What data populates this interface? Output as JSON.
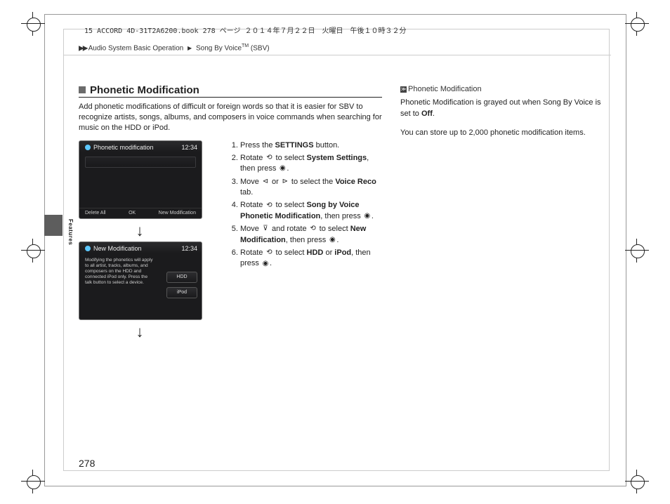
{
  "header": {
    "meta_line": "15 ACCORD 4D-31T2A6200.book  278 ページ  ２０１４年７月２２日　火曜日　午後１０時３２分"
  },
  "breadcrumb": {
    "arrows": "▶▶",
    "part1": "Audio System Basic Operation",
    "part2": "Song By Voice",
    "tm": "TM",
    "suffix": " (SBV)"
  },
  "section": {
    "title": "Phonetic Modification",
    "intro": "Add phonetic modifications of difficult or foreign words so that it is easier for SBV to recognize artists, songs, albums, and composers in voice commands when searching for music on the HDD or iPod."
  },
  "screens": {
    "screen1": {
      "title": "Phonetic modification",
      "time": "12:34",
      "slot_text": "",
      "bottom_left": "Delete All",
      "bottom_mid": "OK",
      "bottom_right": "New Modification"
    },
    "screen2": {
      "title": "New Modification",
      "time": "12:34",
      "desc": "Modifying the phonetics will apply to all artist, tracks, albums, and composers on the HDD and connected iPod only. Press the talk button to select a device.",
      "btn1": "HDD",
      "btn2": "iPod"
    },
    "arrow": "↓"
  },
  "steps": {
    "s1_a": "Press the ",
    "s1_b": "SETTINGS",
    "s1_c": " button.",
    "s2_a": "Rotate ",
    "s2_b": " to select ",
    "s2_c": "System Settings",
    "s2_d": ", then press ",
    "s3_a": "Move ",
    "s3_b": " or ",
    "s3_c": " to select the ",
    "s3_d": "Voice Reco",
    "s3_e": " tab.",
    "s4_a": "Rotate ",
    "s4_b": " to select ",
    "s4_c": "Song by Voice Phonetic Modification",
    "s4_d": ", then press ",
    "s5_a": "Move ",
    "s5_b": " and rotate ",
    "s5_c": " to select ",
    "s5_d": "New Modification",
    "s5_e": ", then press ",
    "s6_a": "Rotate ",
    "s6_b": " to select ",
    "s6_c": "HDD",
    "s6_d": " or ",
    "s6_e": "iPod",
    "s6_f": ", then press ",
    "period": "."
  },
  "sidebar": {
    "heading": "Phonetic Modification",
    "p1_a": "Phonetic Modification is grayed out when Song By Voice is set to ",
    "p1_b": "Off",
    "p1_c": ".",
    "p2": "You can store up to 2,000 phonetic modification items."
  },
  "side_label": "Features",
  "page_number": "278"
}
